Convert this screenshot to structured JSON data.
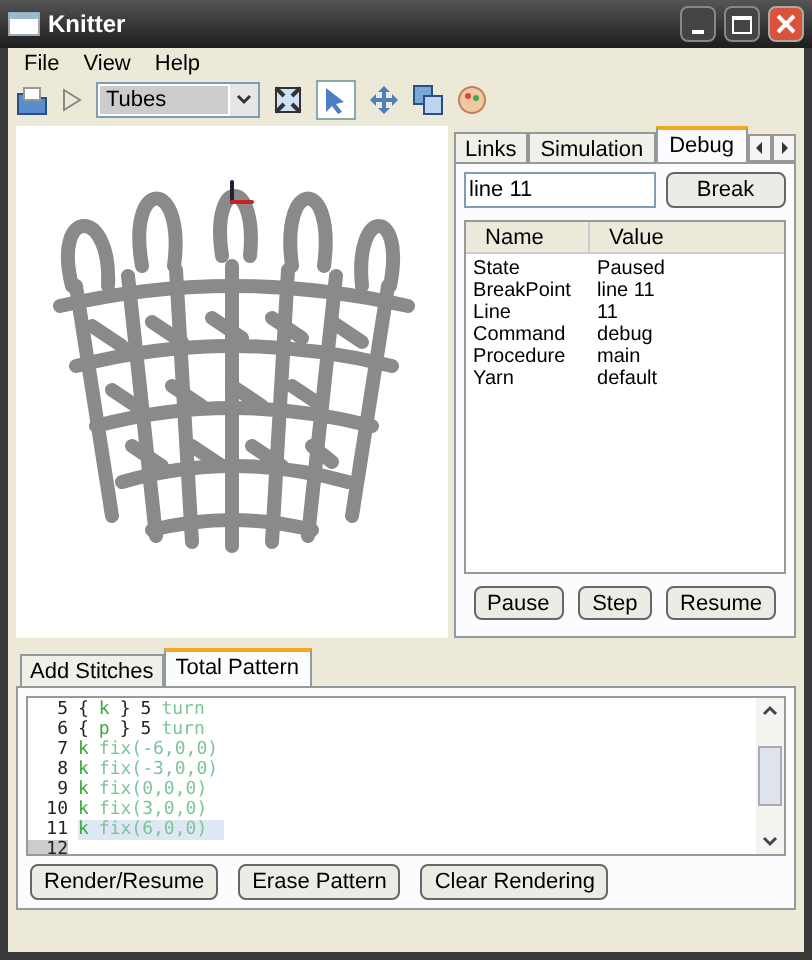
{
  "window": {
    "title": "Knitter"
  },
  "menu": [
    "File",
    "View",
    "Help"
  ],
  "toolbar": {
    "mode_select": "Tubes"
  },
  "right_panel": {
    "tabs": [
      {
        "label": "Links",
        "selected": false
      },
      {
        "label": "Simulation",
        "selected": false
      },
      {
        "label": "Debug",
        "selected": true
      }
    ],
    "break_field": {
      "value": "line 11"
    },
    "break_button": "Break",
    "table": {
      "columns": [
        "Name",
        "Value"
      ],
      "rows": [
        [
          "State",
          "Paused"
        ],
        [
          "BreakPoint",
          "line 11"
        ],
        [
          "Line",
          "11"
        ],
        [
          "Command",
          "debug"
        ],
        [
          "Procedure",
          "main"
        ],
        [
          "Yarn",
          "default"
        ]
      ]
    },
    "buttons": [
      "Pause",
      "Step",
      "Resume"
    ]
  },
  "bottom_tabs": [
    {
      "label": "Add Stitches",
      "selected": false
    },
    {
      "label": "Total Pattern",
      "selected": true
    }
  ],
  "editor": {
    "lines": [
      {
        "number": "5",
        "selected": false,
        "tokens": [
          {
            "text": "{",
            "kind": "punct"
          },
          {
            "text": "k",
            "kind": "stitch"
          },
          {
            "text": "}",
            "kind": "punct"
          },
          {
            "text": "5",
            "kind": "punct"
          },
          {
            "text": "turn",
            "kind": "command"
          }
        ]
      },
      {
        "number": "6",
        "selected": false,
        "tokens": [
          {
            "text": "{",
            "kind": "punct"
          },
          {
            "text": "p",
            "kind": "stitch"
          },
          {
            "text": "}",
            "kind": "punct"
          },
          {
            "text": "5",
            "kind": "punct"
          },
          {
            "text": "turn",
            "kind": "command"
          }
        ]
      },
      {
        "number": "7",
        "selected": false,
        "tokens": [
          {
            "text": "k",
            "kind": "stitch"
          },
          {
            "text": "fix(-6,0,0)",
            "kind": "command"
          }
        ]
      },
      {
        "number": "8",
        "selected": false,
        "tokens": [
          {
            "text": "k",
            "kind": "stitch"
          },
          {
            "text": "fix(-3,0,0)",
            "kind": "command"
          }
        ]
      },
      {
        "number": "9",
        "selected": false,
        "tokens": [
          {
            "text": "k",
            "kind": "stitch"
          },
          {
            "text": "fix(0,0,0)",
            "kind": "command"
          }
        ]
      },
      {
        "number": "10",
        "selected": false,
        "tokens": [
          {
            "text": "k",
            "kind": "stitch"
          },
          {
            "text": "fix(3,0,0)",
            "kind": "command"
          }
        ]
      },
      {
        "number": "11",
        "selected": true,
        "tokens": [
          {
            "text": "k",
            "kind": "stitch"
          },
          {
            "text": "fix(6,0,0)",
            "kind": "command"
          }
        ]
      },
      {
        "number": "12",
        "selected": false
      }
    ]
  },
  "actions": [
    "Render/Resume",
    "Erase Pattern",
    "Clear Rendering"
  ]
}
